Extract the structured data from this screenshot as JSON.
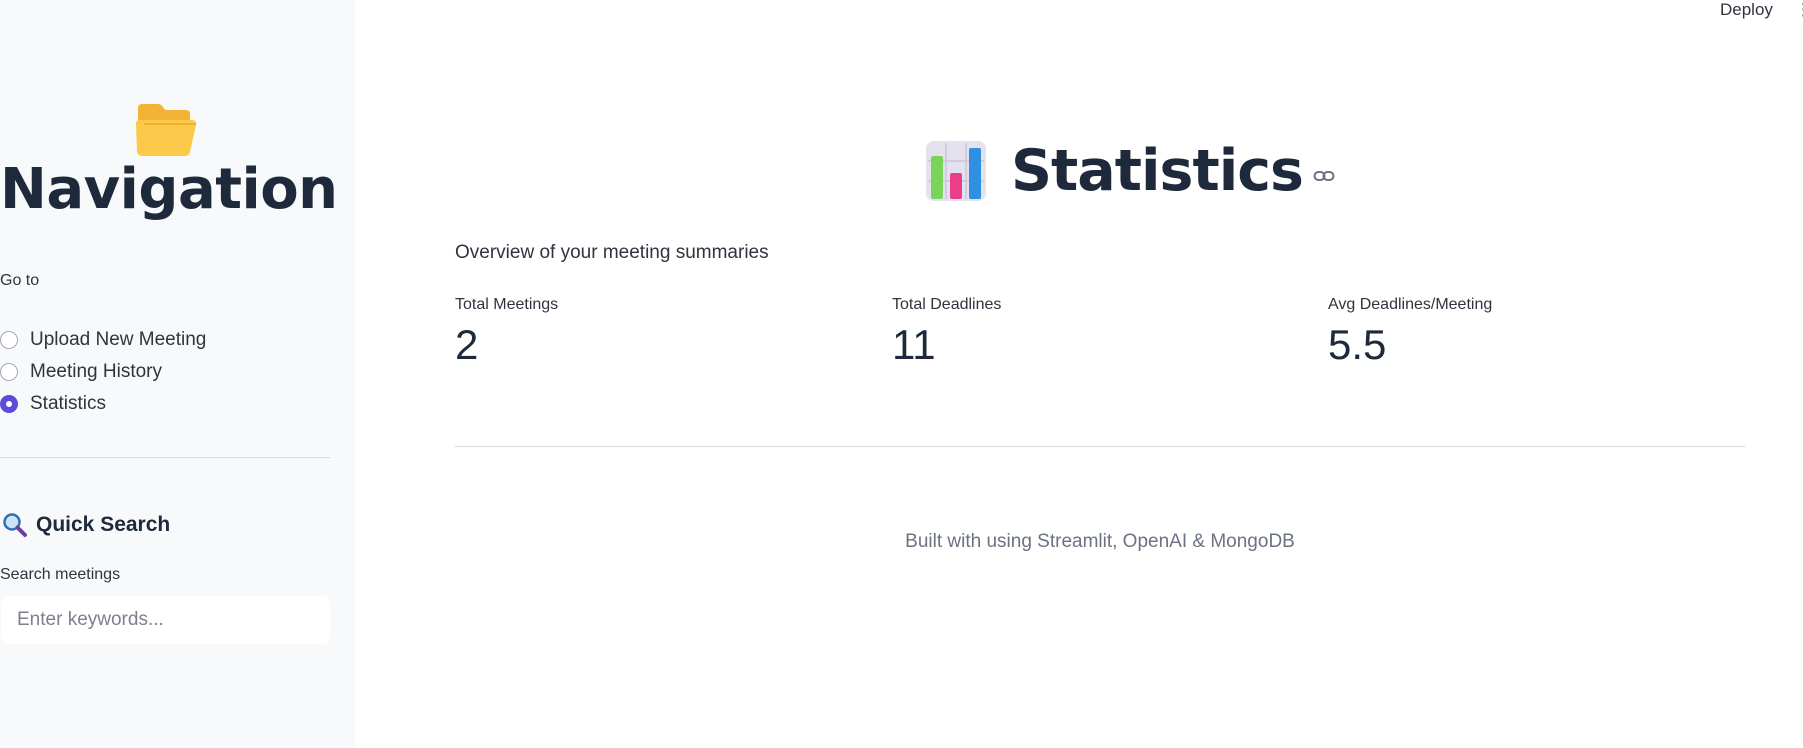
{
  "topbar": {
    "deploy_label": "Deploy",
    "menu_icon": "more-vertical-icon"
  },
  "sidebar": {
    "header_icon": "open-folder-icon",
    "title": "Navigation",
    "goto_label": "Go to",
    "options": [
      {
        "label": "Upload New Meeting",
        "selected": false
      },
      {
        "label": "Meeting History",
        "selected": false
      },
      {
        "label": "Statistics",
        "selected": true
      }
    ],
    "quick_search": {
      "icon": "magnifier-icon",
      "title": "Quick Search",
      "label": "Search meetings",
      "value": "",
      "placeholder": "Enter keywords..."
    }
  },
  "main": {
    "title_icon": "bar-chart-icon",
    "title": "Statistics",
    "anchor_icon": "link-icon",
    "subtitle": "Overview of your meeting summaries",
    "metrics": [
      {
        "label": "Total Meetings",
        "value": "2"
      },
      {
        "label": "Total Deadlines",
        "value": "11"
      },
      {
        "label": "Avg Deadlines/Meeting",
        "value": "5.5"
      }
    ],
    "footer": "Built with using Streamlit, OpenAI & MongoDB"
  },
  "colors": {
    "sidebar_bg": "#f8f9fb",
    "accent": "#5b4bdb",
    "heading": "#1e2a3b",
    "muted_text": "#6b7280"
  }
}
